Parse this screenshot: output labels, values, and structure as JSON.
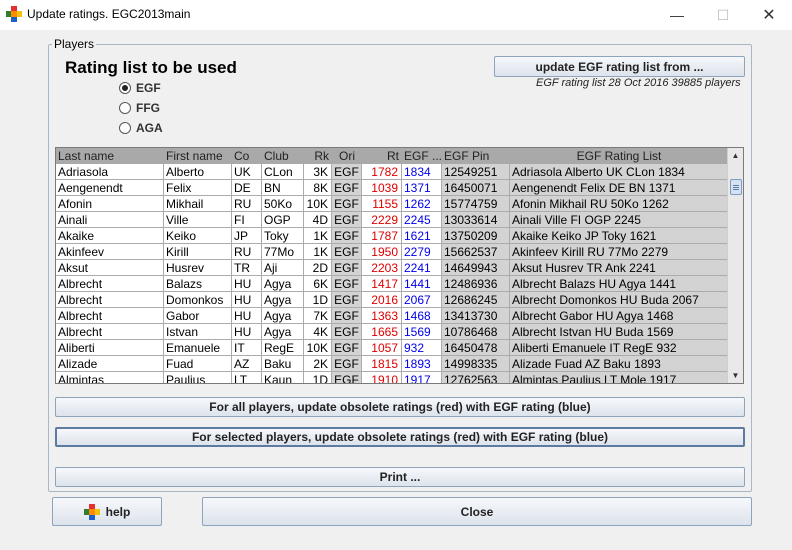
{
  "window": {
    "title": "Update ratings. EGC2013main",
    "minimize_glyph": "—",
    "maximize_glyph": "☐",
    "close_glyph": "✕",
    "icon": "app-logo-icon"
  },
  "panel": {
    "legend": "Players",
    "heading": "Rating list to be used",
    "radios": [
      {
        "label": "EGF",
        "checked": true
      },
      {
        "label": "FFG",
        "checked": false
      },
      {
        "label": "AGA",
        "checked": false
      }
    ],
    "update_list_button": "update EGF rating list from ...",
    "rating_list_info": "EGF rating list 28 Oct 2016 39885 players"
  },
  "table": {
    "columns": [
      "Last name",
      "First name",
      "Co",
      "Club",
      "Rk",
      "Ori",
      "Rt",
      "EGF ...",
      "EGF Pin",
      "EGF Rating List"
    ],
    "rows": [
      [
        "Adriasola",
        "Alberto",
        "UK",
        "CLon",
        "3K",
        "EGF",
        "1782",
        "1834",
        "12549251",
        "Adriasola Alberto UK CLon 1834"
      ],
      [
        "Aengenendt",
        "Felix",
        "DE",
        "BN",
        "8K",
        "EGF",
        "1039",
        "1371",
        "16450071",
        "Aengenendt Felix DE BN 1371"
      ],
      [
        "Afonin",
        "Mikhail",
        "RU",
        "50Ko",
        "10K",
        "EGF",
        "1155",
        "1262",
        "15774759",
        "Afonin Mikhail RU 50Ko 1262"
      ],
      [
        "Ainali",
        "Ville",
        "FI",
        "OGP",
        "4D",
        "EGF",
        "2229",
        "2245",
        "13033614",
        "Ainali Ville FI OGP 2245"
      ],
      [
        "Akaike",
        "Keiko",
        "JP",
        "Toky",
        "1K",
        "EGF",
        "1787",
        "1621",
        "13750209",
        "Akaike Keiko JP Toky 1621"
      ],
      [
        "Akinfeev",
        "Kirill",
        "RU",
        "77Mo",
        "1K",
        "EGF",
        "1950",
        "2279",
        "15662537",
        "Akinfeev Kirill RU 77Mo 2279"
      ],
      [
        "Aksut",
        "Husrev",
        "TR",
        "Aji",
        "2D",
        "EGF",
        "2203",
        "2241",
        "14649943",
        "Aksut Husrev TR Ank 2241"
      ],
      [
        "Albrecht",
        "Balazs",
        "HU",
        "Agya",
        "6K",
        "EGF",
        "1417",
        "1441",
        "12486936",
        "Albrecht Balazs HU Agya 1441"
      ],
      [
        "Albrecht",
        "Domonkos",
        "HU",
        "Agya",
        "1D",
        "EGF",
        "2016",
        "2067",
        "12686245",
        "Albrecht Domonkos HU Buda 2067"
      ],
      [
        "Albrecht",
        "Gabor",
        "HU",
        "Agya",
        "7K",
        "EGF",
        "1363",
        "1468",
        "13413730",
        "Albrecht Gabor HU Agya 1468"
      ],
      [
        "Albrecht",
        "Istvan",
        "HU",
        "Agya",
        "4K",
        "EGF",
        "1665",
        "1569",
        "10786468",
        "Albrecht Istvan HU Buda 1569"
      ],
      [
        "Aliberti",
        "Emanuele",
        "IT",
        "RegE",
        "10K",
        "EGF",
        "1057",
        "932",
        "16450478",
        "Aliberti Emanuele IT RegE 932"
      ],
      [
        "Alizade",
        "Fuad",
        "AZ",
        "Baku",
        "2K",
        "EGF",
        "1815",
        "1893",
        "14998335",
        "Alizade Fuad AZ Baku 1893"
      ],
      [
        "Almintas",
        "Paulius",
        "LT",
        "Kaun",
        "1D",
        "EGF",
        "1910",
        "1917",
        "12762563",
        "Almintas Paulius LT Mole 1917"
      ]
    ]
  },
  "buttons": {
    "update_all": "For all players, update obsolete ratings (red) with EGF rating (blue)",
    "update_selected": "For selected players, update obsolete ratings (red) with EGF rating (blue)",
    "print": "Print ...",
    "help": "help",
    "close": "Close"
  },
  "colors": {
    "obsolete_rating": "#e00000",
    "egf_rating": "#0000ee",
    "header_bg": "#a9a9a9"
  }
}
